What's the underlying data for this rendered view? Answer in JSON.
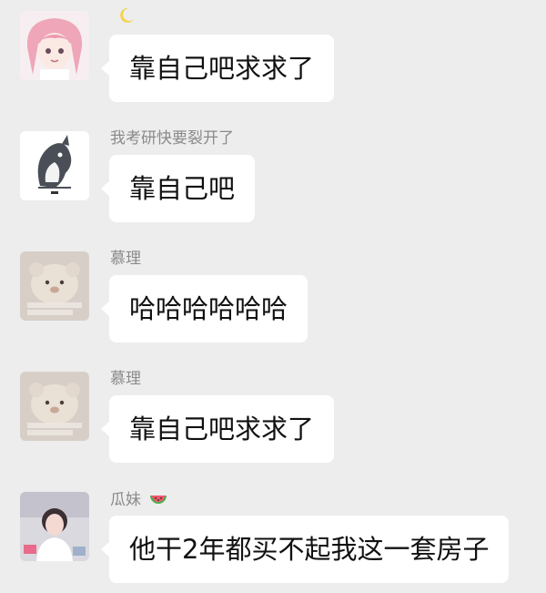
{
  "messages": [
    {
      "sender": "",
      "text": "靠自己吧求求了",
      "avatar": "anime-girl-pink-hair"
    },
    {
      "sender": "我考研快要裂开了",
      "text": "靠自己吧",
      "avatar": "shark-sticker"
    },
    {
      "sender": "慕理",
      "text": "哈哈哈哈哈哈",
      "avatar": "bear-plush"
    },
    {
      "sender": "慕理",
      "text": "靠自己吧求求了",
      "avatar": "bear-plush"
    },
    {
      "sender": "瓜妹",
      "text": "他干2年都买不起我这一套房子",
      "avatar": "girl-photo"
    }
  ],
  "colors": {
    "background": "#ededed",
    "bubble": "#ffffff",
    "name": "#8a8a8a",
    "text": "#111111"
  }
}
